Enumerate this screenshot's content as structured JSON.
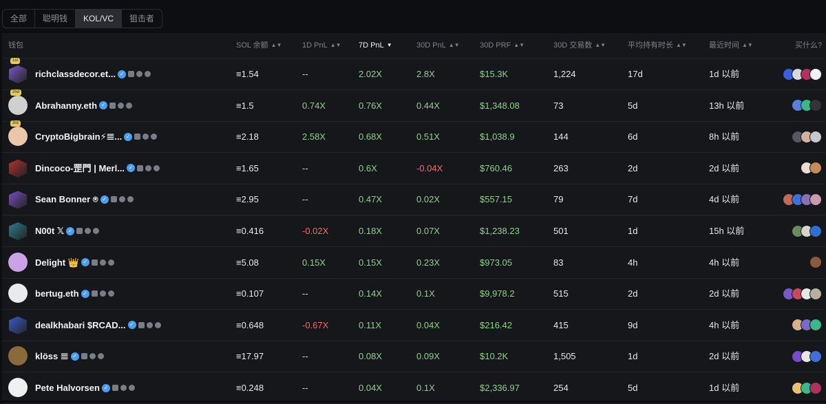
{
  "tabs": [
    {
      "label": "全部",
      "active": false
    },
    {
      "label": "聪明钱",
      "active": false
    },
    {
      "label": "KOL/VC",
      "active": true
    },
    {
      "label": "狙击者",
      "active": false
    }
  ],
  "columns": {
    "wallet": "钱包",
    "sol_balance": "SOL 余额",
    "pnl_1d": "1D PnL",
    "pnl_7d": "7D PnL",
    "pnl_30d": "30D PnL",
    "prf_30d": "30D PRF",
    "trades_30d": "30D 交易数",
    "avg_hold": "平均持有时长",
    "last_time": "最近时间",
    "bought": "买什么?"
  },
  "sol_symbol": "≡",
  "rows": [
    {
      "rank": "1st",
      "name": "richclassdecor.et...",
      "sol": "1.54",
      "pnl_1d": "--",
      "pnl_7d": "2.02X",
      "pnl_30d": "2.8X",
      "prf": "$15.3K",
      "trades": "1,224",
      "hold": "17d",
      "last": "1d 以前",
      "avatar": "#7b58c9",
      "avatar_type": "cube",
      "buyers": [
        "#3a5fd8",
        "#d9d9dc",
        "#b03060",
        "#f2f2f2"
      ]
    },
    {
      "rank": "2nd",
      "name": "Abrahanny.eth",
      "sol": "1.5",
      "pnl_1d": "0.74X",
      "pnl_7d": "0.76X",
      "pnl_30d": "0.44X",
      "prf": "$1,348.08",
      "trades": "73",
      "hold": "5d",
      "last": "13h 以前",
      "avatar": "#d0d0d0",
      "avatar_type": "photo",
      "buyers": [
        "#5b7fe0",
        "#39b889",
        "#333438"
      ]
    },
    {
      "rank": "3rd",
      "name": "CryptoBigbrain⚡𝌆...",
      "sol": "2.18",
      "pnl_1d": "2.58X",
      "pnl_7d": "0.68X",
      "pnl_30d": "0.51X",
      "prf": "$1,038.9",
      "trades": "144",
      "hold": "6d",
      "last": "8h 以前",
      "avatar": "#e9c7a8",
      "avatar_type": "photo",
      "buyers": [
        "#555860",
        "#d4b0a0",
        "#c7c7cc"
      ]
    },
    {
      "rank": "",
      "name": "Dincoco-罡門 | Merl...",
      "sol": "1.65",
      "pnl_1d": "--",
      "pnl_7d": "0.6X",
      "pnl_30d": "-0.04X",
      "prf": "$760.46",
      "trades": "263",
      "hold": "2d",
      "last": "2d 以前",
      "avatar": "#b3322f",
      "avatar_type": "cube",
      "buyers": [
        "#e8ddd0",
        "#c98a5a"
      ]
    },
    {
      "rank": "",
      "name": "Sean Bonner ⍟",
      "sol": "2.95",
      "pnl_1d": "--",
      "pnl_7d": "0.47X",
      "pnl_30d": "0.02X",
      "prf": "$557.15",
      "trades": "79",
      "hold": "7d",
      "last": "4d 以前",
      "avatar": "#7d4fc4",
      "avatar_type": "cube",
      "buyers": [
        "#c06a5a",
        "#3f6fd8",
        "#8a6fb5",
        "#c89ab0"
      ]
    },
    {
      "rank": "",
      "name": "N00t 𝕏",
      "sol": "0.416",
      "pnl_1d": "-0.02X",
      "pnl_7d": "0.18X",
      "pnl_30d": "0.07X",
      "prf": "$1,238.23",
      "trades": "501",
      "hold": "1d",
      "last": "15h 以前",
      "avatar": "#2e7e8e",
      "avatar_type": "cube",
      "buyers": [
        "#6a8a60",
        "#d8d4cc",
        "#2e6fd0"
      ]
    },
    {
      "rank": "",
      "name": "Delight 👑",
      "sol": "5.08",
      "pnl_1d": "0.15X",
      "pnl_7d": "0.15X",
      "pnl_30d": "0.23X",
      "prf": "$973.05",
      "trades": "83",
      "hold": "4h",
      "last": "4h 以前",
      "avatar": "#c9a3e6",
      "avatar_type": "photo",
      "buyers": [
        "#8a5a3a"
      ]
    },
    {
      "rank": "",
      "name": "bertug.eth",
      "sol": "0.107",
      "pnl_1d": "--",
      "pnl_7d": "0.14X",
      "pnl_30d": "0.1X",
      "prf": "$9,978.2",
      "trades": "515",
      "hold": "2d",
      "last": "2d 以前",
      "avatar": "#e8eaee",
      "avatar_type": "photo",
      "buyers": [
        "#7a58c8",
        "#c64a5a",
        "#e6e6e6",
        "#b8b09a"
      ]
    },
    {
      "rank": "",
      "name": "dealkhabari $RCAD...",
      "sol": "0.648",
      "pnl_1d": "-0.67X",
      "pnl_7d": "0.11X",
      "pnl_30d": "0.04X",
      "prf": "$216.42",
      "trades": "415",
      "hold": "9d",
      "last": "4h 以前",
      "avatar": "#3a5cd0",
      "avatar_type": "cube",
      "buyers": [
        "#d8b08a",
        "#7a6ac8",
        "#39b889"
      ]
    },
    {
      "rank": "",
      "name": "klöss 𝌆",
      "sol": "17.97",
      "pnl_1d": "--",
      "pnl_7d": "0.08X",
      "pnl_30d": "0.09X",
      "prf": "$10.2K",
      "trades": "1,505",
      "hold": "1d",
      "last": "2d 以前",
      "avatar": "#8a6a3a",
      "avatar_type": "photo",
      "buyers": [
        "#7a4ac8",
        "#e6e6e6",
        "#3f6fd8"
      ]
    },
    {
      "rank": "",
      "name": "Pete Halvorsen",
      "sol": "0.248",
      "pnl_1d": "--",
      "pnl_7d": "0.04X",
      "pnl_30d": "0.1X",
      "prf": "$2,336.97",
      "trades": "254",
      "hold": "5d",
      "last": "1d 以前",
      "avatar": "#f0f0f0",
      "avatar_type": "photo",
      "buyers": [
        "#e8c070",
        "#39b889",
        "#b03060"
      ]
    }
  ]
}
